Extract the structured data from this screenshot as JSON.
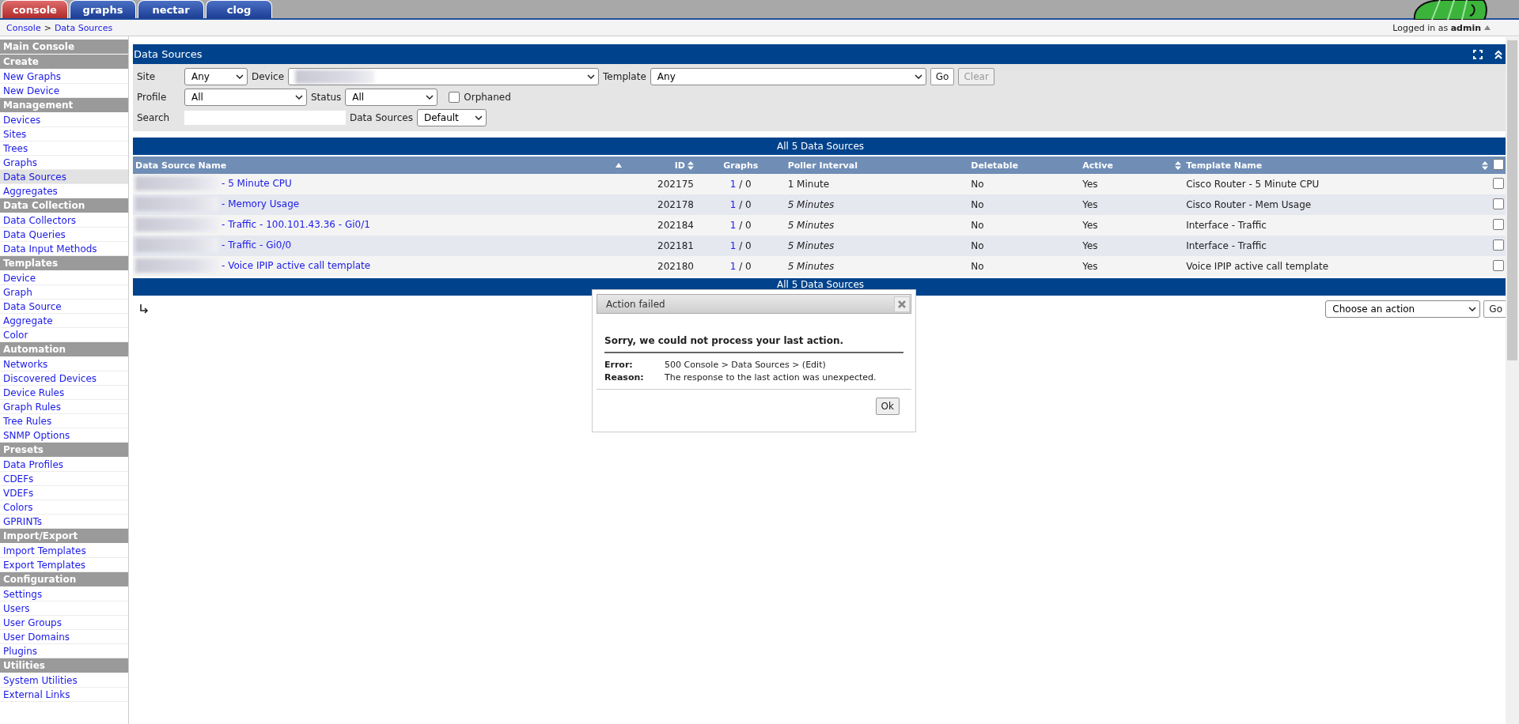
{
  "tabs": [
    {
      "label": "console",
      "selected": true
    },
    {
      "label": "graphs",
      "selected": false
    },
    {
      "label": "nectar",
      "selected": false
    },
    {
      "label": "clog",
      "selected": false
    }
  ],
  "breadcrumb": {
    "items": [
      "Console",
      "Data Sources"
    ],
    "separator": ">"
  },
  "user": {
    "prefix": "Logged in as",
    "name": "admin"
  },
  "sidebar": [
    {
      "kind": "header",
      "label": "Main Console"
    },
    {
      "kind": "header",
      "label": "Create"
    },
    {
      "kind": "item",
      "label": "New Graphs",
      "selected": false
    },
    {
      "kind": "item",
      "label": "New Device",
      "selected": false
    },
    {
      "kind": "header",
      "label": "Management"
    },
    {
      "kind": "item",
      "label": "Devices",
      "selected": false
    },
    {
      "kind": "item",
      "label": "Sites",
      "selected": false
    },
    {
      "kind": "item",
      "label": "Trees",
      "selected": false
    },
    {
      "kind": "item",
      "label": "Graphs",
      "selected": false
    },
    {
      "kind": "item",
      "label": "Data Sources",
      "selected": true
    },
    {
      "kind": "item",
      "label": "Aggregates",
      "selected": false
    },
    {
      "kind": "header",
      "label": "Data Collection"
    },
    {
      "kind": "item",
      "label": "Data Collectors",
      "selected": false
    },
    {
      "kind": "item",
      "label": "Data Queries",
      "selected": false
    },
    {
      "kind": "item",
      "label": "Data Input Methods",
      "selected": false
    },
    {
      "kind": "header",
      "label": "Templates"
    },
    {
      "kind": "item",
      "label": "Device",
      "selected": false
    },
    {
      "kind": "item",
      "label": "Graph",
      "selected": false
    },
    {
      "kind": "item",
      "label": "Data Source",
      "selected": false
    },
    {
      "kind": "item",
      "label": "Aggregate",
      "selected": false
    },
    {
      "kind": "item",
      "label": "Color",
      "selected": false
    },
    {
      "kind": "header",
      "label": "Automation"
    },
    {
      "kind": "item",
      "label": "Networks",
      "selected": false
    },
    {
      "kind": "item",
      "label": "Discovered Devices",
      "selected": false
    },
    {
      "kind": "item",
      "label": "Device Rules",
      "selected": false
    },
    {
      "kind": "item",
      "label": "Graph Rules",
      "selected": false
    },
    {
      "kind": "item",
      "label": "Tree Rules",
      "selected": false
    },
    {
      "kind": "item",
      "label": "SNMP Options",
      "selected": false
    },
    {
      "kind": "header",
      "label": "Presets"
    },
    {
      "kind": "item",
      "label": "Data Profiles",
      "selected": false
    },
    {
      "kind": "item",
      "label": "CDEFs",
      "selected": false
    },
    {
      "kind": "item",
      "label": "VDEFs",
      "selected": false
    },
    {
      "kind": "item",
      "label": "Colors",
      "selected": false
    },
    {
      "kind": "item",
      "label": "GPRINTs",
      "selected": false
    },
    {
      "kind": "header",
      "label": "Import/Export"
    },
    {
      "kind": "item",
      "label": "Import Templates",
      "selected": false
    },
    {
      "kind": "item",
      "label": "Export Templates",
      "selected": false
    },
    {
      "kind": "header",
      "label": "Configuration"
    },
    {
      "kind": "item",
      "label": "Settings",
      "selected": false
    },
    {
      "kind": "item",
      "label": "Users",
      "selected": false
    },
    {
      "kind": "item",
      "label": "User Groups",
      "selected": false
    },
    {
      "kind": "item",
      "label": "User Domains",
      "selected": false
    },
    {
      "kind": "item",
      "label": "Plugins",
      "selected": false
    },
    {
      "kind": "header",
      "label": "Utilities"
    },
    {
      "kind": "item",
      "label": "System Utilities",
      "selected": false
    },
    {
      "kind": "item",
      "label": "External Links",
      "selected": false
    }
  ],
  "panel": {
    "title": "Data Sources",
    "site": {
      "label": "Site",
      "value": "Any"
    },
    "device": {
      "label": "Device"
    },
    "template": {
      "label": "Template",
      "value": "Any"
    },
    "go": "Go",
    "clear": {
      "label": "Clear",
      "disabled": true
    },
    "profile": {
      "label": "Profile",
      "value": "All"
    },
    "status": {
      "label": "Status",
      "value": "All"
    },
    "orphaned": {
      "label": "Orphaned",
      "checked": false
    },
    "search": {
      "label": "Search"
    },
    "data_sources": {
      "label": "Data Sources",
      "value": "Default"
    }
  },
  "table": {
    "title": "All 5 Data Sources",
    "columns": [
      {
        "label": "Data Source Name",
        "sortable": true,
        "sorted": true
      },
      {
        "label": "ID",
        "sortable": true,
        "sorted": false
      },
      {
        "label": "Graphs",
        "sortable": false,
        "sorted": false
      },
      {
        "label": "Poller Interval",
        "sortable": false,
        "sorted": false
      },
      {
        "label": "Deletable",
        "sortable": false,
        "sorted": false
      },
      {
        "label": "Active",
        "sortable": true,
        "sorted": false
      },
      {
        "label": "Template Name",
        "sortable": true,
        "sorted": false
      }
    ],
    "select_all": {
      "checked": false
    },
    "rows": [
      {
        "name": "- 5 Minute CPU",
        "id": "202175",
        "graphs": "1",
        "graphs_rest": "/ 0",
        "poller": "1 Minute",
        "inherited": false,
        "deletable": "No",
        "active": "Yes",
        "template": "Cisco Router - 5 Minute CPU",
        "checked": false
      },
      {
        "name": "- Memory Usage",
        "id": "202178",
        "graphs": "1",
        "graphs_rest": "/ 0",
        "poller": "5 Minutes",
        "inherited": true,
        "deletable": "No",
        "active": "Yes",
        "template": "Cisco Router - Mem Usage",
        "checked": false
      },
      {
        "name": "- Traffic - 100.101.43.36 - Gi0/1",
        "id": "202184",
        "graphs": "1",
        "graphs_rest": "/ 0",
        "poller": "5 Minutes",
        "inherited": true,
        "deletable": "No",
        "active": "Yes",
        "template": "Interface - Traffic",
        "checked": false
      },
      {
        "name": "- Traffic - Gi0/0",
        "id": "202181",
        "graphs": "1",
        "graphs_rest": "/ 0",
        "poller": "5 Minutes",
        "inherited": true,
        "deletable": "No",
        "active": "Yes",
        "template": "Interface - Traffic",
        "checked": false
      },
      {
        "name": "- Voice IPIP active call template",
        "id": "202180",
        "graphs": "1",
        "graphs_rest": "/ 0",
        "poller": "5 Minutes",
        "inherited": true,
        "deletable": "No",
        "active": "Yes",
        "template": "Voice IPIP active call template",
        "checked": false
      }
    ],
    "footer": "All 5 Data Sources"
  },
  "actions": {
    "select": "Choose an action",
    "go": "Go"
  },
  "dialog": {
    "title": "Action failed",
    "message": "Sorry, we could not process your last action.",
    "details": [
      {
        "label": "Error:",
        "value": "500 Console > Data Sources > (Edit)"
      },
      {
        "label": "Reason:",
        "value": "The response to the last action was unexpected."
      }
    ],
    "ok": "Ok"
  }
}
